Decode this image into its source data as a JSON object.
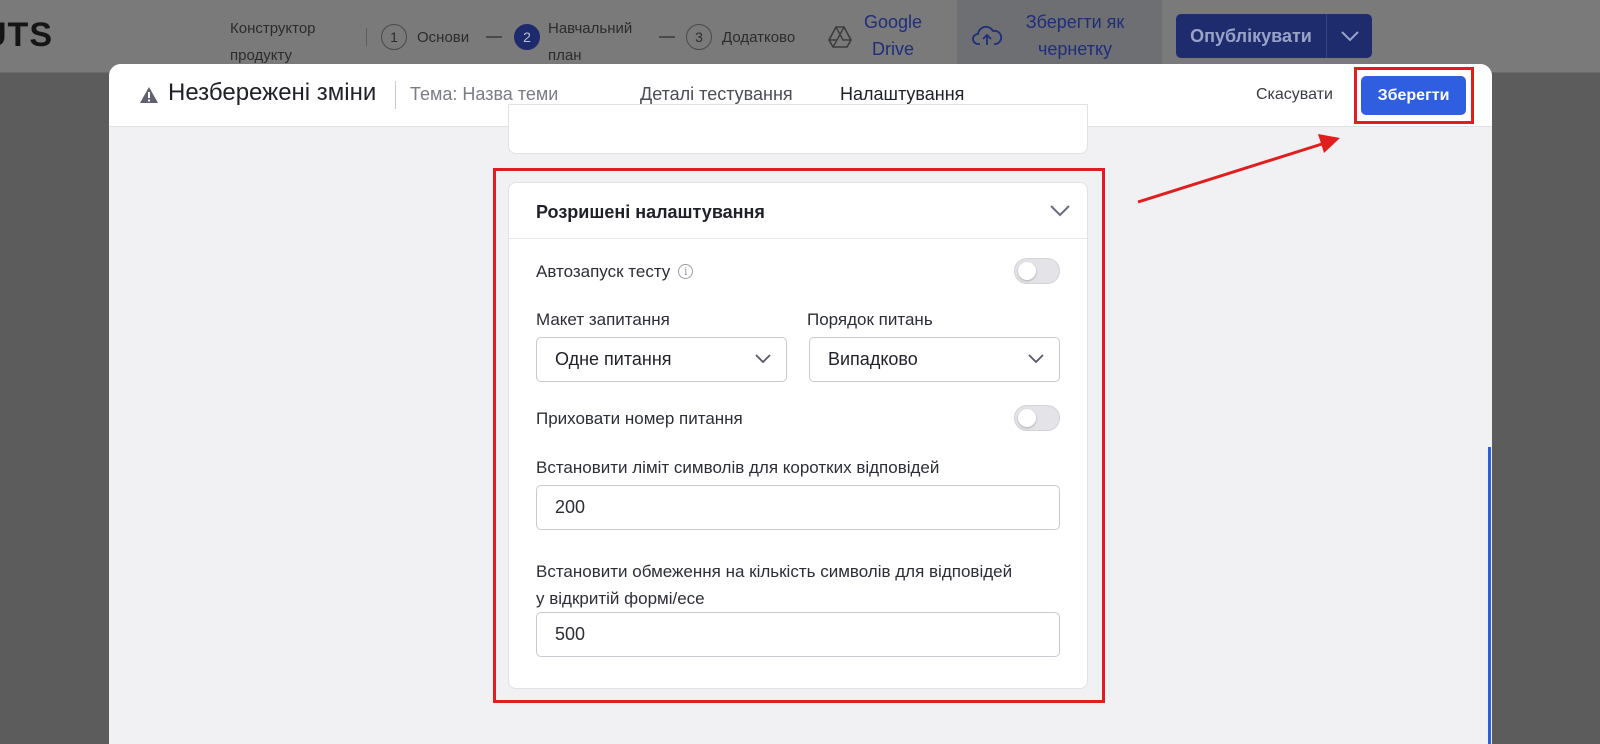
{
  "topbar": {
    "logo": "UTS",
    "builder_label": "Конструктор продукту",
    "steps": [
      {
        "num": "1",
        "label": "Основи"
      },
      {
        "num": "2",
        "label": "Навчальний план"
      },
      {
        "num": "3",
        "label": "Додатково"
      }
    ],
    "google_drive_label": "Google Drive",
    "save_draft_label": "Зберегти як чернетку",
    "publish_label": "Опублікувати"
  },
  "modal": {
    "unsaved_title": "Незбережені зміни",
    "topic_label": "Тема: Назва теми",
    "tabs": [
      {
        "label": "Деталі тестування",
        "active": false
      },
      {
        "label": "Налаштування",
        "active": true
      }
    ],
    "cancel_label": "Скасувати",
    "save_label": "Зберегти"
  },
  "advanced": {
    "title": "Розришені налаштування",
    "autostart_label": "Автозапуск тесту",
    "autostart_enabled": false,
    "layout_label": "Макет запитання",
    "layout_value": "Одне питання",
    "order_label": "Порядок питань",
    "order_value": "Випадково",
    "hide_number_label": "Приховати номер питання",
    "hide_number_enabled": false,
    "short_limit_label": "Встановити ліміт символів для коротких відповідей",
    "short_limit_value": "200",
    "essay_limit_label_line1": "Встановити обмеження на кількість символів для відповідей",
    "essay_limit_label_line2": "у відкритій формі/есе",
    "essay_limit_value": "500"
  },
  "colors": {
    "primary": "#2f5ee0",
    "highlight": "#e01e1e",
    "tab_underline": "#1b55e2"
  },
  "icons": {
    "warning": "warning-icon",
    "info": "info-icon",
    "chevron": "chevron-down-icon",
    "google_drive": "google-drive-icon",
    "cloud_upload": "cloud-upload-icon"
  }
}
